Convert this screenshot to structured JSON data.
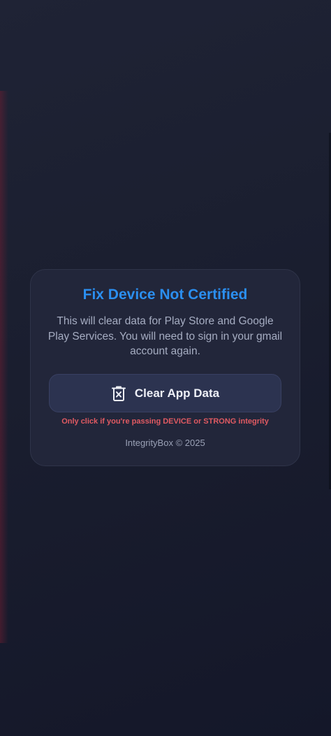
{
  "card": {
    "title": "Fix Device Not Certified",
    "description": "This will clear data for Play Store and Google Play Services. You will need to sign in your gmail account again.",
    "clear_button": {
      "label": "Clear App Data",
      "icon": "trash-x-icon"
    },
    "warning": "Only click if you're passing DEVICE or STRONG integrity",
    "footer": "IntegrityBox © 2025"
  },
  "colors": {
    "background": "#1c2031",
    "card": "#22263a",
    "title": "#2b8ff0",
    "button": "#2c3350",
    "warning": "#e05a62",
    "text_muted": "#a6adc2"
  }
}
